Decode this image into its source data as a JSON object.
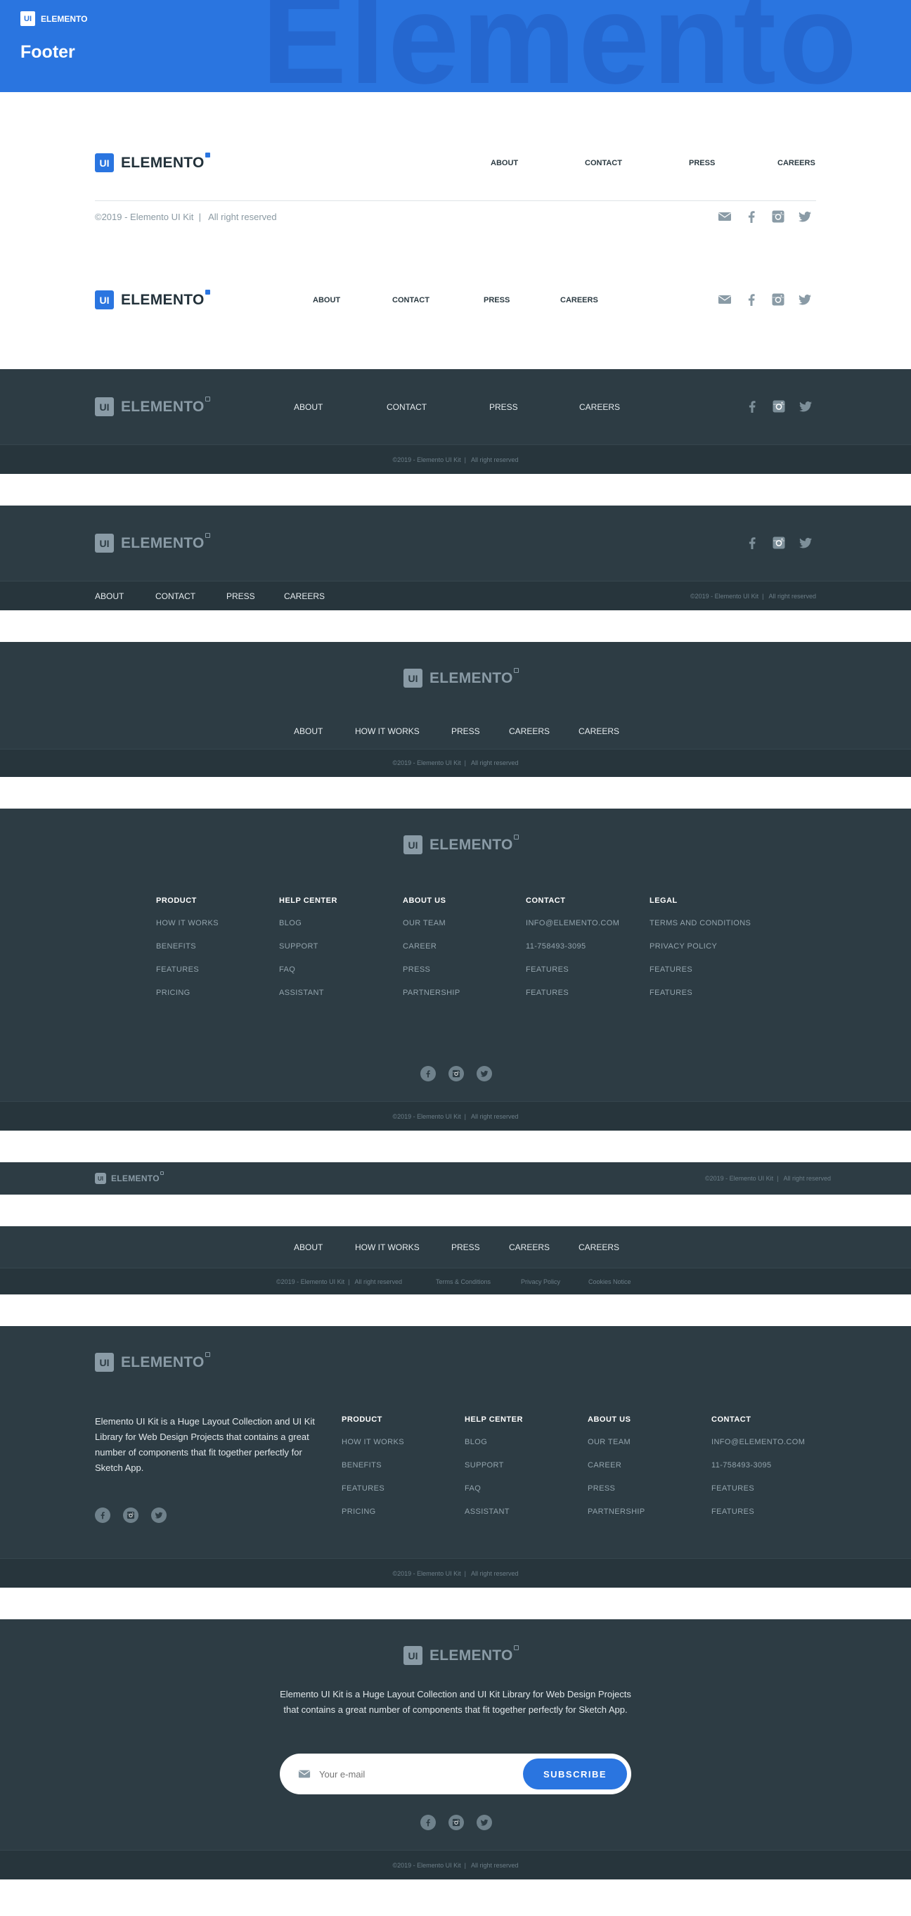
{
  "header": {
    "bg_word": "Elemento",
    "mini_logo": "ELEMENTO",
    "badge": "UI",
    "title": "Footer"
  },
  "logo": {
    "badge": "UI",
    "text": "ELEMENTO"
  },
  "f1": {
    "nav": [
      "ABOUT",
      "CONTACT",
      "PRESS",
      "CAREERS"
    ],
    "copyright": "©2019 - Elemento UI Kit  |   All right reserved"
  },
  "f2": {
    "nav": [
      "ABOUT",
      "CONTACT",
      "PRESS",
      "CAREERS"
    ]
  },
  "f3": {
    "nav": [
      "ABOUT",
      "CONTACT",
      "PRESS",
      "CAREERS"
    ],
    "copyright": "©2019 - Elemento UI Kit  |   All right reserved"
  },
  "f4": {
    "nav": [
      "ABOUT",
      "CONTACT",
      "PRESS",
      "CAREERS"
    ],
    "copyright": "©2019 - Elemento UI Kit  |   All right reserved"
  },
  "f5": {
    "nav": [
      "ABOUT",
      "HOW IT WORKS",
      "PRESS",
      "CAREERS",
      "CAREERS"
    ],
    "copyright": "©2019 - Elemento UI Kit  |   All right reserved"
  },
  "f6": {
    "columns": [
      {
        "title": "PRODUCT",
        "items": [
          "HOW IT WORKS",
          "BENEFITS",
          "FEATURES",
          "PRICING"
        ]
      },
      {
        "title": "HELP CENTER",
        "items": [
          "BLOG",
          "SUPPORT",
          "FAQ",
          "ASSISTANT"
        ]
      },
      {
        "title": "ABOUT US",
        "items": [
          "OUR TEAM",
          "CAREER",
          "PRESS",
          "PARTNERSHIP"
        ]
      },
      {
        "title": "CONTACT",
        "items": [
          "INFO@ELEMENTO.COM",
          "11-758493-3095",
          "FEATURES",
          "FEATURES"
        ]
      },
      {
        "title": "LEGAL",
        "items": [
          "TERMS AND CONDITIONS",
          "PRIVACY POLICY",
          "FEATURES",
          "FEATURES"
        ]
      }
    ],
    "copyright": "©2019 - Elemento UI Kit  |   All right reserved"
  },
  "f7": {
    "copyright": "©2019 - Elemento UI Kit  |   All right reserved"
  },
  "f8": {
    "nav": [
      "ABOUT",
      "HOW IT WORKS",
      "PRESS",
      "CAREERS",
      "CAREERS"
    ],
    "copyright": "©2019 - Elemento UI Kit  |   All right reserved",
    "legal": [
      "Terms & Conditions",
      "Privacy Policy",
      "Cookies Notice"
    ]
  },
  "f9": {
    "description": "Elemento UI Kit is a Huge Layout Collection and UI Kit Library for Web Design Projects that contains a great number of components that fit together perfectly for Sketch App.",
    "columns": [
      {
        "title": "PRODUCT",
        "items": [
          "HOW IT WORKS",
          "BENEFITS",
          "FEATURES",
          "PRICING"
        ]
      },
      {
        "title": "HELP CENTER",
        "items": [
          "BLOG",
          "SUPPORT",
          "FAQ",
          "ASSISTANT"
        ]
      },
      {
        "title": "ABOUT US",
        "items": [
          "OUR TEAM",
          "CAREER",
          "PRESS",
          "PARTNERSHIP"
        ]
      },
      {
        "title": "CONTACT",
        "items": [
          "INFO@ELEMENTO.COM",
          "11-758493-3095",
          "FEATURES",
          "FEATURES"
        ]
      }
    ],
    "copyright": "©2019 - Elemento UI Kit  |   All right reserved"
  },
  "f10": {
    "description": "Elemento UI Kit is a Huge Layout Collection and UI Kit Library for Web Design Projects that contains a great number of components that fit together perfectly for Sketch App.",
    "email_placeholder": "Your e-mail",
    "subscribe": "SUBSCRIBE",
    "copyright": "©2019 - Elemento UI Kit  |   All right reserved"
  },
  "colors": {
    "primary": "#2a75e0",
    "dark": "#2d3c44",
    "strip": "#27353c",
    "muted": "#8a9ba6"
  },
  "icons": [
    "mail-icon",
    "facebook-icon",
    "instagram-icon",
    "twitter-icon"
  ]
}
